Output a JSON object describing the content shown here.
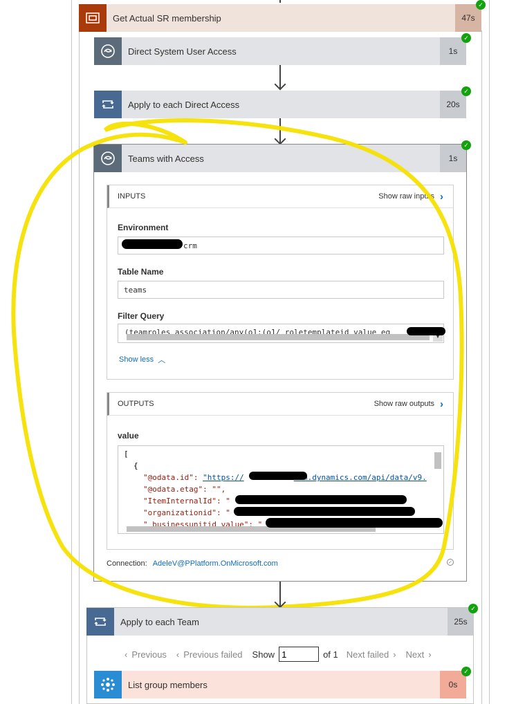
{
  "steps": {
    "get_actual": {
      "title": "Get Actual SR membership",
      "duration": "47s",
      "color": "#a93a0a",
      "head_bg": "#f0e3dc"
    },
    "direct_access": {
      "title": "Direct System User Access",
      "duration": "1s"
    },
    "apply_direct": {
      "title": "Apply to each Direct Access",
      "duration": "20s"
    },
    "teams_with_access": {
      "title": "Teams with Access",
      "duration": "1s"
    },
    "apply_team": {
      "title": "Apply to each Team",
      "duration": "25s"
    },
    "list_group": {
      "title": "List group members",
      "duration": "0s"
    }
  },
  "inputs": {
    "header": "INPUTS",
    "show_raw": "Show raw inputs",
    "environment_label": "Environment",
    "environment_value": "crm",
    "table_label": "Table Name",
    "table_value": "teams",
    "filter_label": "Filter Query",
    "filter_value": "(teamroles_association/any(o1:(o1/_roletemplateid_value eq",
    "show_less": "Show less"
  },
  "outputs": {
    "header": "OUTPUTS",
    "show_raw": "Show raw outputs",
    "value_label": "value",
    "lines": {
      "l0": "[",
      "l1": "{",
      "l2_key": "\"@odata.id\": ",
      "l2_val": "\"https://",
      "l2_tail": "crm.dynamics.com/api/data/v9.",
      "l3": "\"@odata.etag\": \"\",",
      "l4": "\"ItemInternalId\": \"",
      "l5": "\"organizationid\": \"",
      "l6": "\"_businessunitid_value\": \""
    },
    "connection_label": "Connection:",
    "connection_value": "AdeleV@PPlatform.OnMicrosoft.com"
  },
  "pager": {
    "previous": "Previous",
    "previous_failed": "Previous failed",
    "show": "Show",
    "page_value": "1",
    "of": "of 1",
    "next_failed": "Next failed",
    "next": "Next"
  },
  "icons": {
    "dataverse": "dataverse-icon",
    "loop": "loop-icon",
    "scope": "scope-icon",
    "group": "group-members-icon",
    "check": "success-check-icon"
  }
}
